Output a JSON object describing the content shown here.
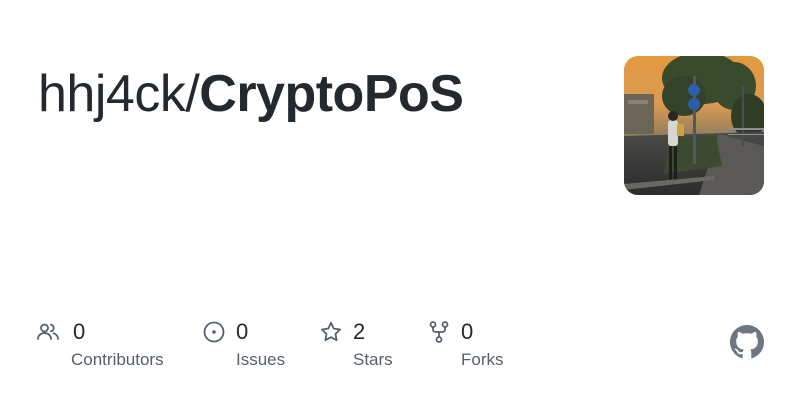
{
  "repo": {
    "owner": "hhj4ck",
    "separator": "/",
    "name": "CryptoPoS"
  },
  "stats": [
    {
      "icon": "contributors-icon",
      "count": "0",
      "label": "Contributors"
    },
    {
      "icon": "issues-icon",
      "count": "0",
      "label": "Issues"
    },
    {
      "icon": "star-icon",
      "count": "2",
      "label": "Stars"
    },
    {
      "icon": "fork-icon",
      "count": "0",
      "label": "Forks"
    }
  ],
  "colors": {
    "text": "#24292f",
    "muted": "#57606a",
    "icon": "#57606a",
    "github_mark": "#6e7781"
  }
}
